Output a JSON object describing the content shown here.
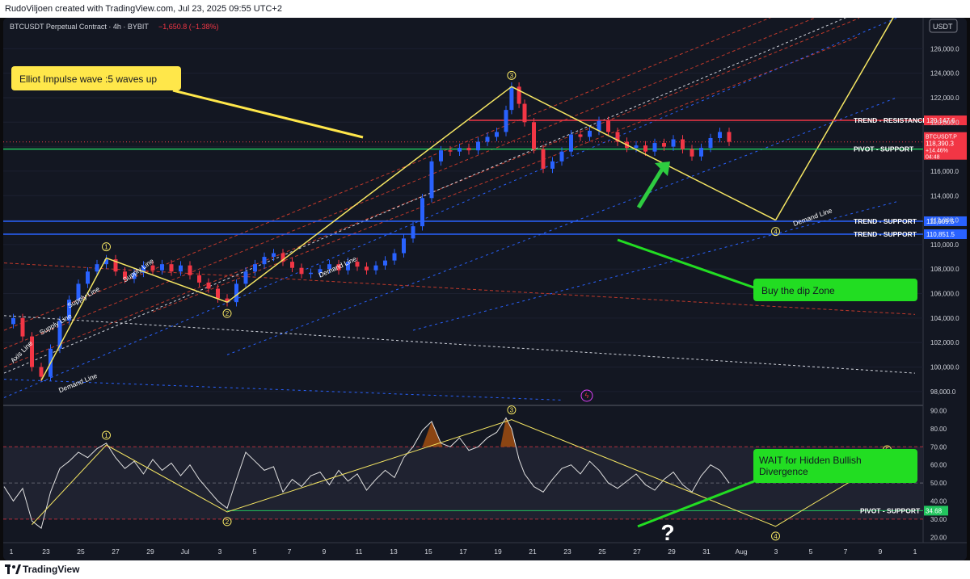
{
  "header": {
    "credit": "RudoViljoen created with TradingView.com, Jul 23, 2025 09:55 UTC+2"
  },
  "footer": {
    "brand": "TradingView"
  },
  "symbol_info": {
    "name": "BTCUSDT Perpetual Contract · 4h · BYBIT",
    "change": "−1,650.8 (−1.38%)",
    "currency": "USDT"
  },
  "colors": {
    "background": "#131722",
    "candle_up": "#2962ff",
    "candle_down": "#f23645",
    "wave": "#f5e663",
    "resistance": "#f23645",
    "pivot": "#22c55e",
    "support": "#2962ff",
    "callout_yellow": "#ffe74a",
    "callout_green": "#22dd22"
  },
  "annotations": {
    "elliott_box": "Elliot Impulse wave :5 waves up",
    "buy_box": "Buy the dip Zone",
    "wait_box": "WAIT for Hidden Bullish Divergence",
    "question": "?"
  },
  "chart_data": [
    {
      "type": "line",
      "title": "BTCUSDT Perpetual Contract · 4h · BYBIT",
      "y_axis_label": "USDT",
      "ylim": [
        97000,
        128000
      ],
      "y_ticks": [
        "126,000.0",
        "124,000.0",
        "122,000.0",
        "120,000.0",
        "118,000.0",
        "116,000.0",
        "114,000.0",
        "112,000.0",
        "110,000.0",
        "108,000.0",
        "106,000.0",
        "104,000.0",
        "102,000.0",
        "100,000.0",
        "98,000.0"
      ],
      "x_ticks": [
        "1",
        "23",
        "25",
        "27",
        "29",
        "Jul",
        "3",
        "5",
        "7",
        "9",
        "11",
        "13",
        "15",
        "17",
        "19",
        "21",
        "23",
        "25",
        "27",
        "29",
        "31",
        "Aug",
        "3",
        "5",
        "7",
        "9",
        "1"
      ],
      "price_series": {
        "name": "BTCUSDT",
        "points": [
          [
            -2,
            103500
          ],
          [
            -1.5,
            104000
          ],
          [
            -1,
            102500
          ],
          [
            -0.5,
            100000
          ],
          [
            0,
            99200
          ],
          [
            0.5,
            101500
          ],
          [
            1,
            103800
          ],
          [
            1.5,
            105500
          ],
          [
            2,
            106800
          ],
          [
            2.5,
            107800
          ],
          [
            3,
            108400
          ],
          [
            3.5,
            108800
          ],
          [
            4,
            107800
          ],
          [
            4.5,
            107200
          ],
          [
            5,
            107700
          ],
          [
            5.5,
            108300
          ],
          [
            6,
            107900
          ],
          [
            6.5,
            108400
          ],
          [
            7,
            107800
          ],
          [
            7.5,
            108300
          ],
          [
            8,
            107500
          ],
          [
            8.5,
            106900
          ],
          [
            9,
            106400
          ],
          [
            9.5,
            105600
          ],
          [
            10,
            105300
          ],
          [
            10.5,
            106800
          ],
          [
            11,
            107800
          ],
          [
            11.5,
            108400
          ],
          [
            12,
            109000
          ],
          [
            12.5,
            109300
          ],
          [
            13,
            108600
          ],
          [
            13.5,
            108100
          ],
          [
            14,
            107600
          ],
          [
            14.5,
            107700
          ],
          [
            15,
            108000
          ],
          [
            15.5,
            108400
          ],
          [
            16,
            107900
          ],
          [
            16.5,
            108600
          ],
          [
            17,
            108200
          ],
          [
            17.5,
            107900
          ],
          [
            18,
            108300
          ],
          [
            18.5,
            108700
          ],
          [
            19,
            109300
          ],
          [
            19.5,
            110500
          ],
          [
            20,
            111500
          ],
          [
            20.5,
            113800
          ],
          [
            21,
            116800
          ],
          [
            21.5,
            117700
          ],
          [
            22,
            117600
          ],
          [
            22.5,
            117900
          ],
          [
            23,
            117700
          ],
          [
            23.5,
            118400
          ],
          [
            24,
            118800
          ],
          [
            24.5,
            119200
          ],
          [
            25,
            121000
          ],
          [
            25.3,
            122900
          ],
          [
            25.7,
            121500
          ],
          [
            26,
            120000
          ],
          [
            26.5,
            117800
          ],
          [
            27,
            116200
          ],
          [
            27.5,
            116800
          ],
          [
            28,
            117600
          ],
          [
            28.5,
            119000
          ],
          [
            29,
            118800
          ],
          [
            29.5,
            119300
          ],
          [
            30,
            120100
          ],
          [
            30.5,
            119200
          ],
          [
            31,
            118400
          ],
          [
            31.5,
            117900
          ],
          [
            32,
            118100
          ],
          [
            32.5,
            117600
          ],
          [
            33,
            118300
          ],
          [
            33.5,
            118000
          ],
          [
            34,
            118600
          ],
          [
            34.5,
            117800
          ],
          [
            35,
            117200
          ],
          [
            35.5,
            117900
          ],
          [
            36,
            118700
          ],
          [
            36.5,
            119200
          ],
          [
            37,
            118400
          ]
        ]
      },
      "horizontal_levels": [
        {
          "name": "TREND - RESISTANCE",
          "value": 120147.6,
          "label": "120,147.6",
          "color": "#f23645"
        },
        {
          "name": "PIVOT - SUPPORT",
          "value": 117801.6,
          "label": "117,801.6",
          "color": "#22c55e"
        },
        {
          "name": "TREND - SUPPORT",
          "value": 111909.5,
          "label": "111,909.5",
          "color": "#2962ff"
        },
        {
          "name": "TREND - SUPPORT",
          "value": 110851.5,
          "label": "110,851.5",
          "color": "#2962ff"
        }
      ],
      "last_price": {
        "ticker": "BTCUSDT.P",
        "price": "118,390.3",
        "change": "+14.46%",
        "countdown": "04:48"
      },
      "elliott_waves": [
        {
          "label": "1",
          "x": 3.5,
          "y": 108900
        },
        {
          "label": "2",
          "x": 10,
          "y": 105300
        },
        {
          "label": "3",
          "x": 25.3,
          "y": 122900
        },
        {
          "label": "4",
          "x": 39.5,
          "y": 112000
        }
      ],
      "trendline_labels": [
        "Supply Line",
        "Supply Line",
        "Supply Line",
        "Axis Line",
        "Demand Line",
        "Demand Line",
        "Demand Line"
      ]
    },
    {
      "type": "line",
      "ylim": [
        17,
        92
      ],
      "y_ticks": [
        "90.00",
        "80.00",
        "70.00",
        "60.00",
        "50.00",
        "40.00",
        "30.00",
        "20.00"
      ],
      "levels": [
        {
          "name": "PIVOT - SUPPORT",
          "value": 34.68,
          "label": "34.68",
          "color": "#22c55e"
        }
      ],
      "bands": {
        "upper": 70,
        "middle": 50,
        "lower": 30
      },
      "rsi_series": {
        "name": "RSI",
        "points": [
          [
            -2,
            48
          ],
          [
            -1.5,
            40
          ],
          [
            -1,
            47
          ],
          [
            -0.5,
            29
          ],
          [
            0,
            25
          ],
          [
            0.5,
            45
          ],
          [
            1,
            58
          ],
          [
            1.5,
            62
          ],
          [
            2,
            67
          ],
          [
            2.5,
            64
          ],
          [
            3,
            69
          ],
          [
            3.5,
            72
          ],
          [
            4,
            64
          ],
          [
            4.5,
            58
          ],
          [
            5,
            62
          ],
          [
            5.5,
            55
          ],
          [
            6,
            63
          ],
          [
            6.5,
            57
          ],
          [
            7,
            61
          ],
          [
            7.5,
            54
          ],
          [
            8,
            60
          ],
          [
            8.5,
            52
          ],
          [
            9,
            46
          ],
          [
            9.5,
            40
          ],
          [
            10,
            36
          ],
          [
            10.5,
            52
          ],
          [
            11,
            67
          ],
          [
            11.5,
            62
          ],
          [
            12,
            57
          ],
          [
            12.5,
            59
          ],
          [
            13,
            45
          ],
          [
            13.5,
            52
          ],
          [
            14,
            48
          ],
          [
            14.5,
            54
          ],
          [
            15,
            56
          ],
          [
            15.5,
            49
          ],
          [
            16,
            57
          ],
          [
            16.5,
            51
          ],
          [
            17,
            55
          ],
          [
            17.5,
            46
          ],
          [
            18,
            52
          ],
          [
            18.5,
            57
          ],
          [
            19,
            53
          ],
          [
            19.5,
            64
          ],
          [
            20,
            70
          ],
          [
            20.5,
            79
          ],
          [
            21,
            84
          ],
          [
            21.5,
            72
          ],
          [
            22,
            70
          ],
          [
            22.5,
            75
          ],
          [
            23,
            68
          ],
          [
            23.5,
            70
          ],
          [
            24,
            75
          ],
          [
            24.5,
            78
          ],
          [
            25,
            86
          ],
          [
            25.3,
            80
          ],
          [
            25.7,
            63
          ],
          [
            26,
            55
          ],
          [
            26.5,
            48
          ],
          [
            27,
            45
          ],
          [
            27.5,
            52
          ],
          [
            28,
            58
          ],
          [
            28.5,
            60
          ],
          [
            29,
            55
          ],
          [
            29.5,
            62
          ],
          [
            30,
            57
          ],
          [
            30.5,
            50
          ],
          [
            31,
            47
          ],
          [
            31.5,
            51
          ],
          [
            32,
            55
          ],
          [
            32.5,
            49
          ],
          [
            33,
            46
          ],
          [
            33.5,
            52
          ],
          [
            34,
            56
          ],
          [
            34.5,
            49
          ],
          [
            35,
            45
          ],
          [
            35.5,
            54
          ],
          [
            36,
            60
          ],
          [
            36.5,
            57
          ],
          [
            37,
            50
          ]
        ]
      },
      "wave_points": [
        {
          "label": "1",
          "x": 3.5,
          "y": 71
        },
        {
          "label": "2",
          "x": 10,
          "y": 34
        },
        {
          "label": "3",
          "x": 25.3,
          "y": 85
        },
        {
          "label": "4",
          "x": 39.5,
          "y": 26
        },
        {
          "label": "5",
          "x": 45.5,
          "y": 63
        }
      ]
    }
  ]
}
